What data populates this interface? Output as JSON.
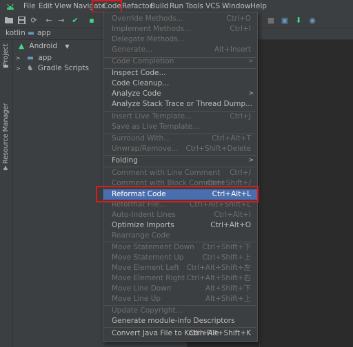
{
  "menubar": {
    "items": [
      "File",
      "Edit",
      "View",
      "Navigate",
      "Code",
      "Refactor",
      "Build",
      "Run",
      "Tools",
      "VCS",
      "Window",
      "Help"
    ]
  },
  "nav": {
    "project": "kotlin",
    "module": "app"
  },
  "tool_strip": {
    "project": "Project",
    "resource_manager": "Resource Manager"
  },
  "project_panel": {
    "view_mode": "Android",
    "nodes": [
      "app",
      "Gradle Scripts"
    ]
  },
  "code_menu": {
    "items": [
      {
        "label": "Override Methods...",
        "shortcut": "Ctrl+O",
        "enabled": false
      },
      {
        "label": "Implement Methods...",
        "shortcut": "Ctrl+I",
        "enabled": false
      },
      {
        "label": "Delegate Methods...",
        "shortcut": "",
        "enabled": false
      },
      {
        "label": "Generate...",
        "shortcut": "Alt+Insert",
        "enabled": false
      },
      {
        "label": "Code Completion",
        "shortcut": "",
        "enabled": false,
        "submenu": true
      },
      {
        "label": "Inspect Code...",
        "shortcut": "",
        "enabled": true
      },
      {
        "label": "Code Cleanup...",
        "shortcut": "",
        "enabled": true
      },
      {
        "label": "Analyze Code",
        "shortcut": "",
        "enabled": true,
        "submenu": true
      },
      {
        "label": "Analyze Stack Trace or Thread Dump...",
        "shortcut": "",
        "enabled": true
      },
      {
        "label": "Insert Live Template...",
        "shortcut": "Ctrl+J",
        "enabled": false
      },
      {
        "label": "Save as Live Template...",
        "shortcut": "",
        "enabled": false
      },
      {
        "label": "Surround With...",
        "shortcut": "Ctrl+Alt+T",
        "enabled": false
      },
      {
        "label": "Unwrap/Remove...",
        "shortcut": "Ctrl+Shift+Delete",
        "enabled": false
      },
      {
        "label": "Folding",
        "shortcut": "",
        "enabled": true,
        "submenu": true
      },
      {
        "label": "Comment with Line Comment",
        "shortcut": "Ctrl+/",
        "enabled": false
      },
      {
        "label": "Comment with Block Comment",
        "shortcut": "Ctrl+Shift+/",
        "enabled": false
      },
      {
        "label": "Reformat Code",
        "shortcut": "Ctrl+Alt+L",
        "enabled": true,
        "selected": true
      },
      {
        "label": "Reformat File...",
        "shortcut": "Ctrl+Alt+Shift+L",
        "enabled": false
      },
      {
        "label": "Auto-Indent Lines",
        "shortcut": "Ctrl+Alt+I",
        "enabled": false
      },
      {
        "label": "Optimize Imports",
        "shortcut": "Ctrl+Alt+O",
        "enabled": true
      },
      {
        "label": "Rearrange Code",
        "shortcut": "",
        "enabled": false
      },
      {
        "label": "Move Statement Down",
        "shortcut": "Ctrl+Shift+下",
        "enabled": false
      },
      {
        "label": "Move Statement Up",
        "shortcut": "Ctrl+Shift+上",
        "enabled": false
      },
      {
        "label": "Move Element Left",
        "shortcut": "Ctrl+Alt+Shift+左",
        "enabled": false
      },
      {
        "label": "Move Element Right",
        "shortcut": "Ctrl+Alt+Shift+右",
        "enabled": false
      },
      {
        "label": "Move Line Down",
        "shortcut": "Alt+Shift+下",
        "enabled": false
      },
      {
        "label": "Move Line Up",
        "shortcut": "Alt+Shift+上",
        "enabled": false
      },
      {
        "label": "Update Copyright...",
        "shortcut": "",
        "enabled": false
      },
      {
        "label": "Generate module-info Descriptors",
        "shortcut": "",
        "enabled": true
      },
      {
        "label": "Convert Java File to Kotlin File",
        "shortcut": "Ctrl+Alt+Shift+K",
        "enabled": true
      }
    ]
  },
  "colors": {
    "accent_selection": "#4b6eaf",
    "highlight_box": "#e0191c",
    "android_green": "#3ddc84"
  }
}
